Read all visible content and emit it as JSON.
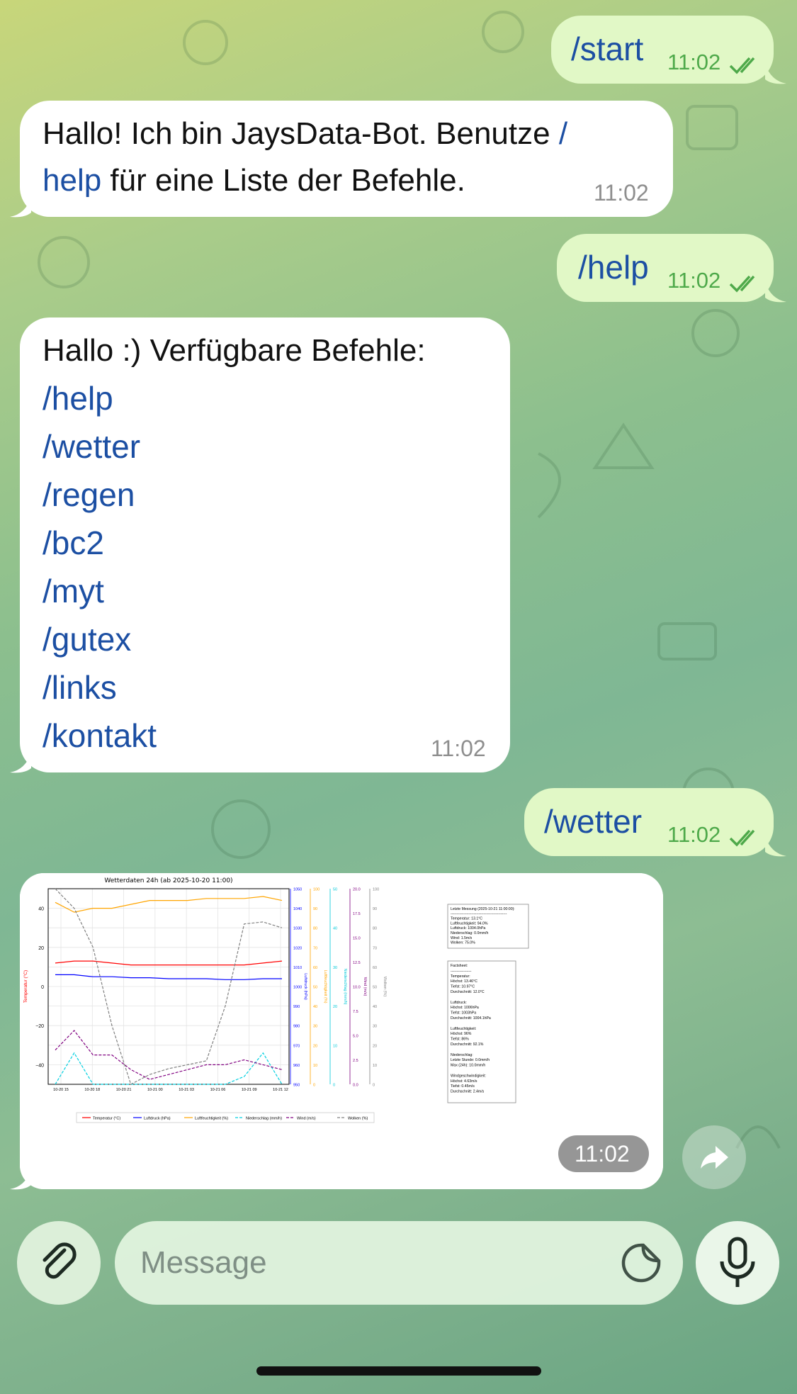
{
  "messages": {
    "m1": {
      "text": "/start",
      "time": "11:02"
    },
    "m2": {
      "text_before": "Hallo! Ich bin JaysData-Bot. Benutze ",
      "link_part1": "/",
      "link_part2": "help",
      "text_after": " für eine Liste der Befehle.",
      "time": "11:02"
    },
    "m3": {
      "text": "/help",
      "time": "11:02"
    },
    "m4": {
      "heading": "Hallo :) Verfügbare Befehle:",
      "commands": [
        "/help",
        "/wetter",
        "/regen",
        "/bc2",
        "/myt",
        "/gutex",
        "/links",
        "/kontakt"
      ],
      "time": "11:02"
    },
    "m5": {
      "text": "/wetter",
      "time": "11:02"
    },
    "m6": {
      "time": "11:02"
    }
  },
  "composer": {
    "placeholder": "Message"
  },
  "icons": {
    "attach": "paperclip-icon",
    "sticker": "sticker-icon",
    "mic": "microphone-icon",
    "forward": "forward-icon",
    "read": "double-check-icon"
  },
  "colors": {
    "outgoing": "#e1f8c6",
    "incoming": "#ffffff",
    "link": "#1c4fa3",
    "time_out": "#4ea94a"
  },
  "chart_data": {
    "type": "line",
    "title": "Wetterdaten 24h (ab 2025-10-20 11:00)",
    "x_ticks": [
      "10-20 15",
      "10-20 18",
      "10-20 21",
      "10-21 00",
      "10-21 03",
      "10-21 06",
      "10-21 09",
      "10-21 12"
    ],
    "axes": {
      "temperature": {
        "label": "Temperatur (°C)",
        "ylim": [
          -50,
          50
        ],
        "ticks": [
          "40",
          "20",
          "0",
          "−20",
          "−40"
        ]
      },
      "pressure": {
        "label": "Luftdruck (hPa)",
        "ylim": [
          950,
          1050
        ],
        "ticks": [
          "1050",
          "1040",
          "1030",
          "1020",
          "1010",
          "1000",
          "990",
          "980",
          "970",
          "960",
          "950"
        ]
      },
      "humidity": {
        "label": "Luftfeuchtigkeit (%)",
        "ylim": [
          0,
          100
        ],
        "ticks": [
          "100",
          "90",
          "80",
          "70",
          "60",
          "50",
          "40",
          "30",
          "20",
          "10",
          "0"
        ]
      },
      "precipitation": {
        "label": "Niederschlag (mm/h)",
        "ylim": [
          0,
          50
        ],
        "ticks": [
          "50",
          "40",
          "30",
          "20",
          "10",
          "0"
        ]
      },
      "wind": {
        "label": "Wind (m/s)",
        "ylim": [
          0,
          20
        ],
        "ticks": [
          "20.0",
          "17.5",
          "15.0",
          "12.5",
          "10.0",
          "7.5",
          "5.0",
          "2.5",
          "0.0"
        ]
      },
      "clouds": {
        "label": "Wolken (%)",
        "ylim": [
          0,
          100
        ],
        "ticks": [
          "100",
          "90",
          "80",
          "70",
          "60",
          "50",
          "40",
          "30",
          "20",
          "10",
          "0"
        ]
      }
    },
    "series": [
      {
        "name": "Temperatur (°C)",
        "x": [
          0,
          2,
          4,
          6,
          8,
          10,
          12,
          14,
          16,
          18,
          20,
          22,
          24
        ],
        "values": [
          12,
          13,
          13,
          12,
          11,
          11,
          11,
          11,
          11,
          11,
          11,
          12,
          13
        ]
      },
      {
        "name": "Luftdruck (hPa)",
        "x": [
          0,
          2,
          4,
          6,
          8,
          10,
          12,
          14,
          16,
          18,
          20,
          22,
          24
        ],
        "values": [
          1006,
          1006,
          1005,
          1005,
          1004.5,
          1004.5,
          1004,
          1004,
          1004,
          1003.5,
          1003.5,
          1004,
          1004
        ]
      },
      {
        "name": "Luftfeuchtigkeit (%)",
        "x": [
          0,
          2,
          4,
          6,
          8,
          10,
          12,
          14,
          16,
          18,
          20,
          22,
          24
        ],
        "values": [
          93,
          88,
          90,
          90,
          92,
          94,
          94,
          94,
          95,
          95,
          95,
          96,
          94
        ]
      },
      {
        "name": "Niederschlag (mm/h)",
        "x": [
          0,
          2,
          4,
          6,
          8,
          10,
          12,
          14,
          16,
          18,
          20,
          22,
          24
        ],
        "values": [
          0,
          8,
          0,
          0,
          0,
          0,
          0,
          0,
          0,
          0,
          2,
          8,
          0
        ]
      },
      {
        "name": "Wind (m/s)",
        "x": [
          0,
          2,
          4,
          6,
          8,
          10,
          12,
          14,
          16,
          18,
          20,
          22,
          24
        ],
        "values": [
          3.5,
          5.5,
          3,
          3,
          1.5,
          0.5,
          1,
          1.5,
          2,
          2,
          2.5,
          2,
          1.5
        ]
      },
      {
        "name": "Wolken (%)",
        "x": [
          0,
          2,
          4,
          6,
          8,
          10,
          12,
          14,
          16,
          18,
          20,
          22,
          24
        ],
        "values": [
          100,
          90,
          70,
          30,
          0,
          5,
          8,
          10,
          12,
          40,
          82,
          83,
          80
        ]
      }
    ],
    "legend": "bottom",
    "grid": true,
    "info_last": [
      "Letzte Messung (2025-10-21 11:00:00):",
      "----------------------------------------------",
      "Temperatur: 13.1°C",
      "Luftfeuchtigkeit: 94.0%",
      "Luftdruck: 1004.0hPa",
      "Niederschlag: 0.0mm/h",
      "Wind: 1.5m/s",
      "Wolken: 75.0%"
    ],
    "info_facts": [
      "Factsheet:",
      "-----------------",
      "Temperatur:",
      "  Höchst: 13.46°C",
      "  Tiefst: 10.97°C",
      "  Durchschnitt: 12.0°C",
      "",
      "Luftdruck:",
      "  Höchst: 1006hPa",
      "  Tiefst: 1003hPa",
      "  Durchschnitt: 1004.1hPa",
      "",
      "Luftfeuchtigkeit:",
      "  Höchst: 96%",
      "  Tiefst: 86%",
      "  Durchschnitt: 92.1%",
      "",
      "Niederschlag:",
      "  Letzte Stunde: 0.0mm/h",
      "  Max (24h): 10.0mm/h",
      "",
      "Windgeschwindigkeit:",
      "  Höchst: 4.63m/s",
      "  Tiefst: 0.45m/s",
      "  Durchschnitt: 2.4m/s"
    ]
  }
}
